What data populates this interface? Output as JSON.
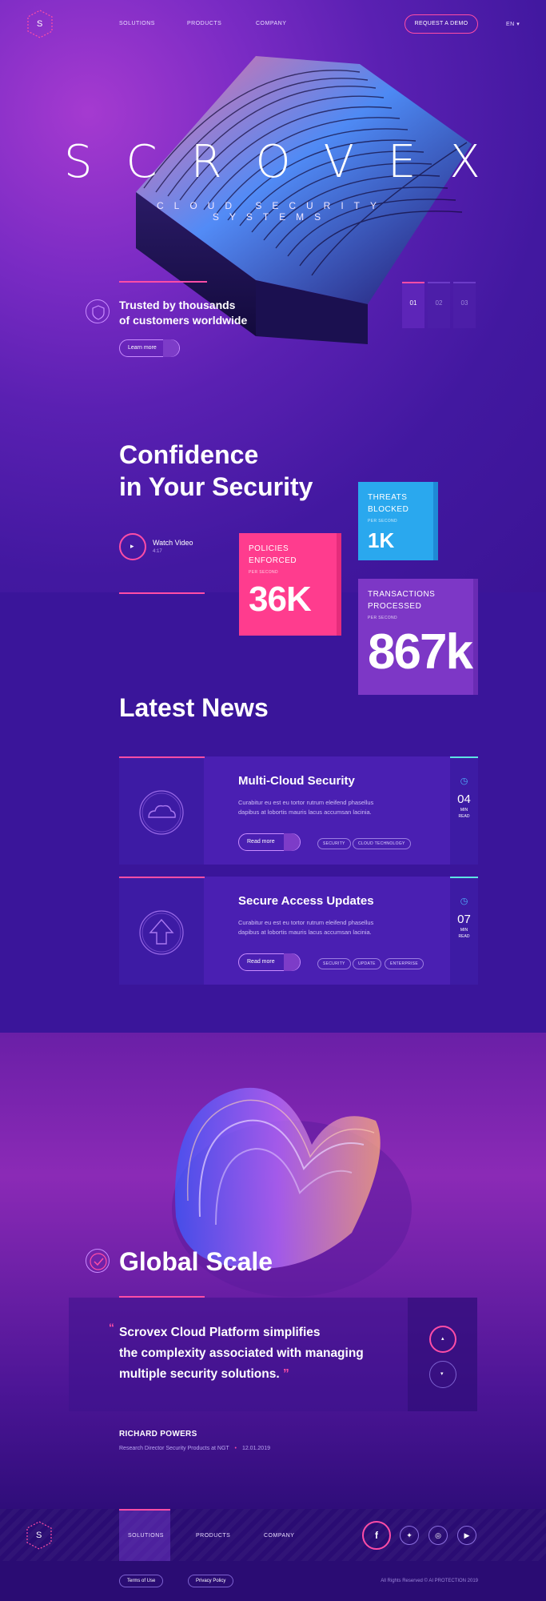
{
  "nav": {
    "logo_letter": "S",
    "items": [
      "SOLUTIONS",
      "PRODUCTS",
      "COMPANY"
    ],
    "cta": "REQUEST A DEMO",
    "lang": "EN"
  },
  "hero": {
    "title": "SCROVEX",
    "subtitle": "CLOUD SECURITY SYSTEMS",
    "trusted_line1": "Trusted by thousands",
    "trusted_line2": "of customers worldwide",
    "learn_more": "Learn more",
    "slides": [
      "01",
      "02",
      "03"
    ],
    "active_slide": "01"
  },
  "confidence": {
    "line1": "Confidence",
    "line2": "in Your Security",
    "watch": "Watch Video",
    "duration": "4:17"
  },
  "stats": [
    {
      "label1": "THREATS",
      "label2": "BLOCKED",
      "per": "PER SECOND",
      "value": "1K",
      "color": "#2aa8ee"
    },
    {
      "label1": "POLICIES",
      "label2": "ENFORCED",
      "per": "PER SECOND",
      "value": "36K",
      "color": "#ff3c8e"
    },
    {
      "label1": "TRANSACTIONS",
      "label2": "PROCESSED",
      "per": "PER SECOND",
      "value": "867k",
      "color": "#7d37c6"
    }
  ],
  "news": {
    "heading": "Latest News",
    "read_more": "Read more",
    "items": [
      {
        "title": "Multi-Cloud Security",
        "body1": "Curabitur eu est eu tortor rutrum eleifend phasellus",
        "body2": "dapibus at lobortis mauris lacus accumsan lacinia.",
        "tags": [
          "SECURITY",
          "CLOUD TECHNOLOGY"
        ],
        "min": "04",
        "min_label": "MIN",
        "read_label": "READ"
      },
      {
        "title": "Secure Access Updates",
        "body1": "Curabitur eu est eu tortor rutrum eleifend phasellus",
        "body2": "dapibus at lobortis mauris lacus accumsan lacinia.",
        "tags": [
          "SECURITY",
          "UPDATE",
          "ENTERPRISE"
        ],
        "min": "07",
        "min_label": "MIN",
        "read_label": "READ"
      }
    ]
  },
  "global": {
    "heading": "Global Scale",
    "quote1": "Scrovex Cloud Platform simplifies",
    "quote2": "the complexity associated with managing",
    "quote3": "multiple security solutions.",
    "author": "RICHARD POWERS",
    "role": "Research Director Security Products at NGT",
    "date": "12.01.2019"
  },
  "footer": {
    "items": [
      "SOLUTIONS",
      "PRODUCTS",
      "COMPANY"
    ],
    "terms": "Terms of Use",
    "privacy": "Privacy Policy",
    "rights": "All Rights Reserved © AI PROTECTION 2019"
  }
}
